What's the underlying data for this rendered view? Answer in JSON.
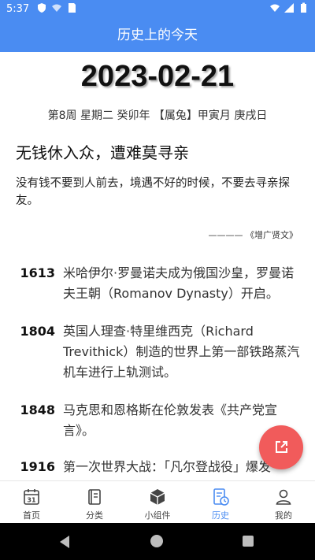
{
  "status_bar": {
    "time": "5:37"
  },
  "app_bar": {
    "title": "历史上的今天"
  },
  "date": "2023-02-21",
  "lunar_info": "第8周 星期二 癸卯年 【属兔】甲寅月 庚戌日",
  "proverb": {
    "title": "无钱休入众，遭难莫寻亲",
    "body": "没有钱不要到人前去，境遇不好的时候，不要去寻亲探友。",
    "source": "———— 《增广贤文》"
  },
  "events": [
    {
      "year": "1613",
      "text": "米哈伊尔·罗曼诺夫成为俄国沙皇，罗曼诺夫王朝（Romanov Dynasty）开启。"
    },
    {
      "year": "1804",
      "text": "英国人理查·特里维西克（Richard Trevithick）制造的世界上第一部铁路蒸汽机车进行上轨测试。"
    },
    {
      "year": "1848",
      "text": "马克思和恩格斯在伦敦发表《共产党宣言》。"
    },
    {
      "year": "1916",
      "text": "第一次世界大战：「凡尔登战役」爆发"
    }
  ],
  "tabs": [
    {
      "label": "首页",
      "icon": "calendar-icon"
    },
    {
      "label": "分类",
      "icon": "book-icon"
    },
    {
      "label": "小组件",
      "icon": "box-icon"
    },
    {
      "label": "历史",
      "icon": "history-icon"
    },
    {
      "label": "我的",
      "icon": "user-icon"
    }
  ],
  "active_tab": "历史",
  "colors": {
    "primary": "#4a8cf2",
    "fab": "#f15b5b"
  }
}
